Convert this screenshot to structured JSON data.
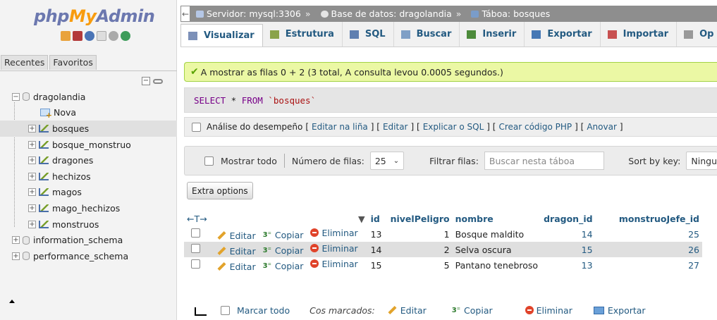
{
  "logo": {
    "php": "php",
    "my": "My",
    "admin": "Admin"
  },
  "nav": {
    "tabs": [
      "Recentes",
      "Favoritos"
    ],
    "tree": [
      {
        "label": "dragolandia",
        "expander": "−",
        "type": "db",
        "selected": false,
        "indent": 0
      },
      {
        "label": "Nova",
        "expander": "",
        "type": "new",
        "selected": false,
        "indent": 1
      },
      {
        "label": "bosques",
        "expander": "+",
        "type": "table",
        "selected": true,
        "indent": 1
      },
      {
        "label": "bosque_monstruo",
        "expander": "+",
        "type": "table",
        "selected": false,
        "indent": 1
      },
      {
        "label": "dragones",
        "expander": "+",
        "type": "table",
        "selected": false,
        "indent": 1
      },
      {
        "label": "hechizos",
        "expander": "+",
        "type": "table",
        "selected": false,
        "indent": 1
      },
      {
        "label": "magos",
        "expander": "+",
        "type": "table",
        "selected": false,
        "indent": 1
      },
      {
        "label": "mago_hechizos",
        "expander": "+",
        "type": "table",
        "selected": false,
        "indent": 1
      },
      {
        "label": "monstruos",
        "expander": "+",
        "type": "table",
        "selected": false,
        "indent": 1
      },
      {
        "label": "information_schema",
        "expander": "+",
        "type": "db",
        "selected": false,
        "indent": 0
      },
      {
        "label": "performance_schema",
        "expander": "+",
        "type": "db",
        "selected": false,
        "indent": 0
      }
    ]
  },
  "breadcrumb": {
    "back": "←",
    "items": [
      "Servidor: mysql:3306",
      "Base de datos: dragolandia",
      "Táboa: bosques"
    ],
    "separator": "»"
  },
  "tabs": [
    {
      "label": "Visualizar",
      "active": true,
      "color": "#7c90b8"
    },
    {
      "label": "Estrutura",
      "active": false,
      "color": "#8aa34a"
    },
    {
      "label": "SQL",
      "active": false,
      "color": "#5f7fb0"
    },
    {
      "label": "Buscar",
      "active": false,
      "color": "#7f9fc6"
    },
    {
      "label": "Inserir",
      "active": false,
      "color": "#4d8b3b"
    },
    {
      "label": "Exportar",
      "active": false,
      "color": "#4678b5"
    },
    {
      "label": "Importar",
      "active": false,
      "color": "#c85050"
    },
    {
      "label": "Op",
      "active": false,
      "color": "#999999"
    }
  ],
  "message": {
    "text": "A mostrar as filas 0 + 2 (3 total, A consulta levou 0.0005 segundos.)"
  },
  "sql": {
    "kw1": "SELECT",
    "star": " * ",
    "kw2": "FROM",
    "table": " `bosques`"
  },
  "profiling": {
    "label": "Análise do desempeño",
    "links": [
      "Editar na liña",
      "Editar",
      "Explicar o SQL",
      "Crear código PHP",
      "Anovar"
    ]
  },
  "navbar": {
    "show_all": "Mostrar todo",
    "rows_label": "Número de filas:",
    "rows_value": "25",
    "filter_label": "Filtrar filas:",
    "filter_placeholder": "Buscar nesta táboa",
    "sort_label": "Sort by key:",
    "sort_value": "Ningu"
  },
  "extra_options": "Extra options",
  "table": {
    "sort_arrows": "←T→",
    "sort_indicator": "▼",
    "columns": [
      "id",
      "nivelPeligro",
      "nombre",
      "dragon_id",
      "monstruoJefe_id"
    ],
    "actions": {
      "edit": "Editar",
      "copy": "Copiar",
      "delete": "Eliminar"
    },
    "rows": [
      {
        "id": "13",
        "nivelPeligro": "1",
        "nombre": "Bosque maldito",
        "dragon_id": "14",
        "monstruoJefe_id": "25"
      },
      {
        "id": "14",
        "nivelPeligro": "2",
        "nombre": "Selva oscura",
        "dragon_id": "15",
        "monstruoJefe_id": "26"
      },
      {
        "id": "15",
        "nivelPeligro": "5",
        "nombre": "Pantano tenebroso",
        "dragon_id": "13",
        "monstruoJefe_id": "27"
      }
    ]
  },
  "bottom": {
    "check_all": "Marcar todo",
    "with_selected": "Cos marcados:",
    "edit": "Editar",
    "copy": "Copiar",
    "delete": "Eliminar",
    "export": "Exportar"
  },
  "colors": {
    "link": "#235a81",
    "success_bg": "#ebf8a4",
    "selected_row": "#dfdfdf",
    "crumb_bar": "#8e8e8e"
  }
}
